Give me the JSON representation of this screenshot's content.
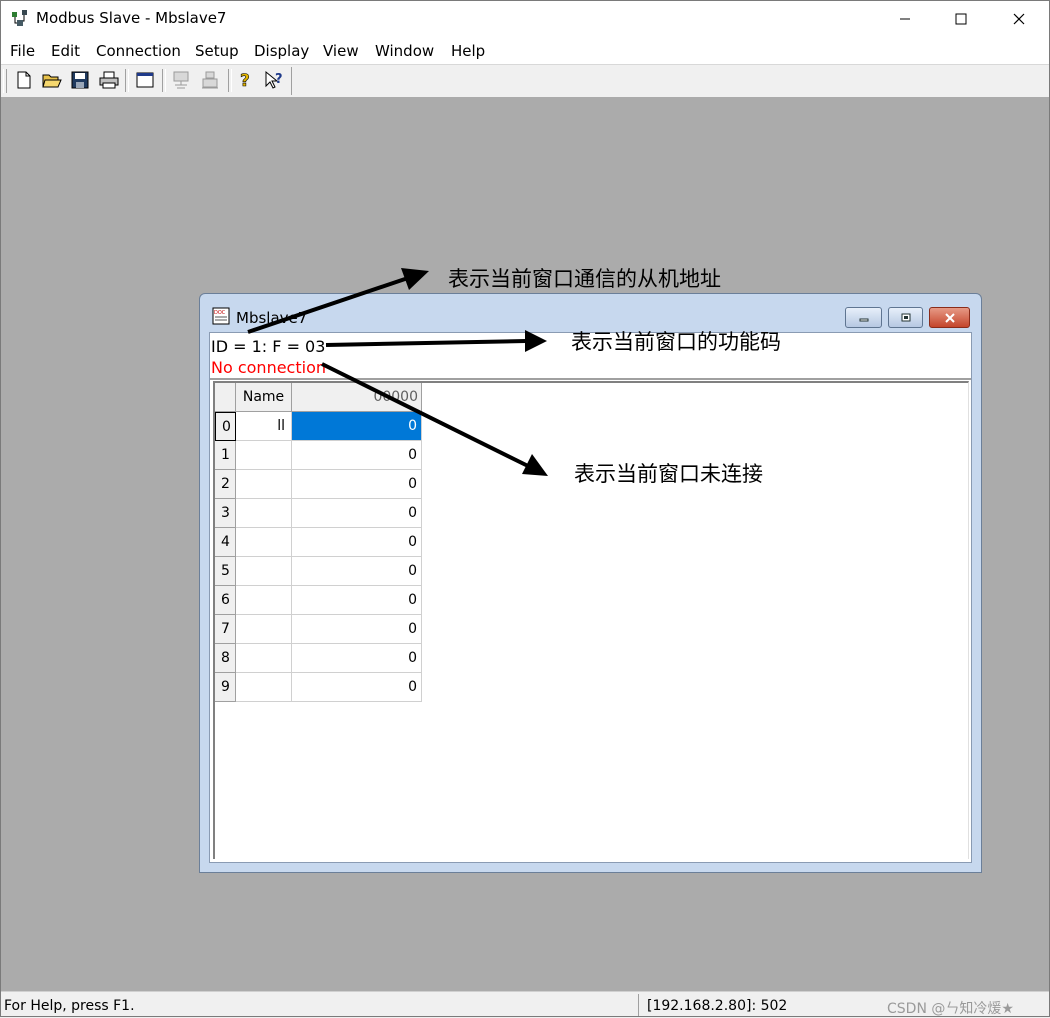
{
  "window": {
    "title": "Modbus Slave - Mbslave7"
  },
  "menu": [
    "File",
    "Edit",
    "Connection",
    "Setup",
    "Display",
    "View",
    "Window",
    "Help"
  ],
  "toolbar": {
    "buttons": [
      "new-icon",
      "open-folder-icon",
      "save-icon",
      "print-icon",
      "window-icon",
      "connect-icon",
      "disconnect-icon",
      "help-icon",
      "context-help-icon"
    ]
  },
  "child": {
    "title": "Mbslave7",
    "id_line": "ID = 1: F = 03",
    "connection_status": "No connection",
    "grid": {
      "header_name": "Name",
      "header_address": "00000",
      "rows": [
        {
          "index": "0",
          "name": "ll",
          "value": "0"
        },
        {
          "index": "1",
          "name": "",
          "value": "0"
        },
        {
          "index": "2",
          "name": "",
          "value": "0"
        },
        {
          "index": "3",
          "name": "",
          "value": "0"
        },
        {
          "index": "4",
          "name": "",
          "value": "0"
        },
        {
          "index": "5",
          "name": "",
          "value": "0"
        },
        {
          "index": "6",
          "name": "",
          "value": "0"
        },
        {
          "index": "7",
          "name": "",
          "value": "0"
        },
        {
          "index": "8",
          "name": "",
          "value": "0"
        },
        {
          "index": "9",
          "name": "",
          "value": "0"
        }
      ]
    }
  },
  "annotations": {
    "slave_address": "表示当前窗口通信的从机地址",
    "function_code": "表示当前窗口的功能码",
    "not_connected": "表示当前窗口未连接"
  },
  "status": {
    "help": "For Help, press F1.",
    "address": "[192.168.2.80]: 502"
  },
  "watermark": "CSDN @ㄣ知冷煖★",
  "colors": {
    "mdi_background": "#ababab",
    "selection": "#0078d7",
    "status_error": "#ff0000"
  }
}
